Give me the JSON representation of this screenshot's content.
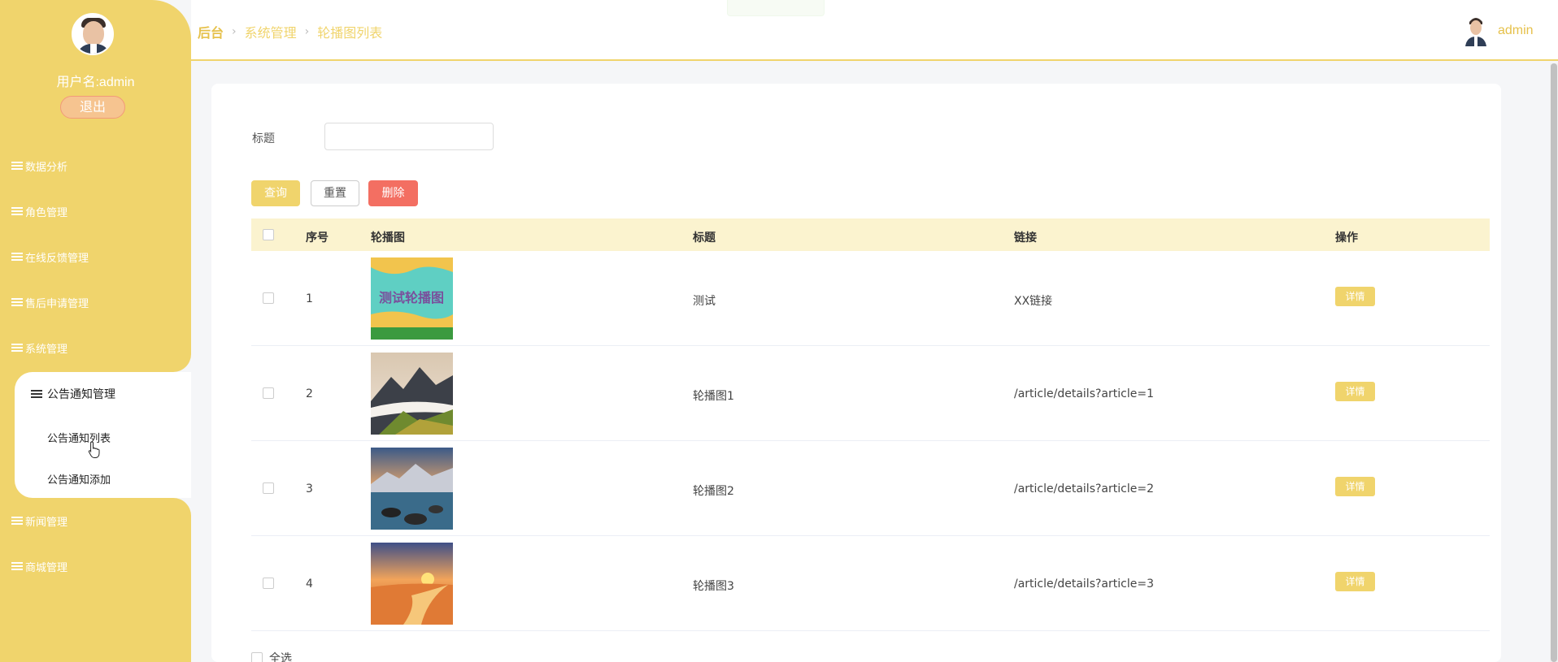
{
  "sidebar": {
    "username": "用户名:admin",
    "logout_label": "退出",
    "items": [
      {
        "label": "数据分析"
      },
      {
        "label": "角色管理"
      },
      {
        "label": "在线反馈管理"
      },
      {
        "label": "售后申请管理"
      },
      {
        "label": "系统管理"
      },
      {
        "label": "新闻管理"
      },
      {
        "label": "商城管理"
      }
    ],
    "submenu": {
      "title": "公告通知管理",
      "items": [
        "公告通知列表",
        "公告通知添加"
      ]
    },
    "accent_color": "#f0d46c"
  },
  "header": {
    "breadcrumb": [
      "后台",
      "系统管理",
      "轮播图列表"
    ],
    "user": "admin"
  },
  "search": {
    "title_label": "标题",
    "title_value": "",
    "query_label": "查询",
    "reset_label": "重置",
    "delete_label": "删除"
  },
  "table": {
    "columns": [
      "序号",
      "轮播图",
      "标题",
      "链接",
      "操作"
    ],
    "rows": [
      {
        "index": "1",
        "image": "banner-test",
        "title": "测试",
        "link": "XX链接",
        "action": "详情"
      },
      {
        "index": "2",
        "image": "mountain-mist",
        "title": "轮播图1",
        "link": "/article/details?article=1",
        "action": "详情"
      },
      {
        "index": "3",
        "image": "lake-mountains",
        "title": "轮播图2",
        "link": "/article/details?article=2",
        "action": "详情"
      },
      {
        "index": "4",
        "image": "beach-sunset",
        "title": "轮播图3",
        "link": "/article/details?article=3",
        "action": "详情"
      }
    ],
    "select_all_label": "全选"
  }
}
